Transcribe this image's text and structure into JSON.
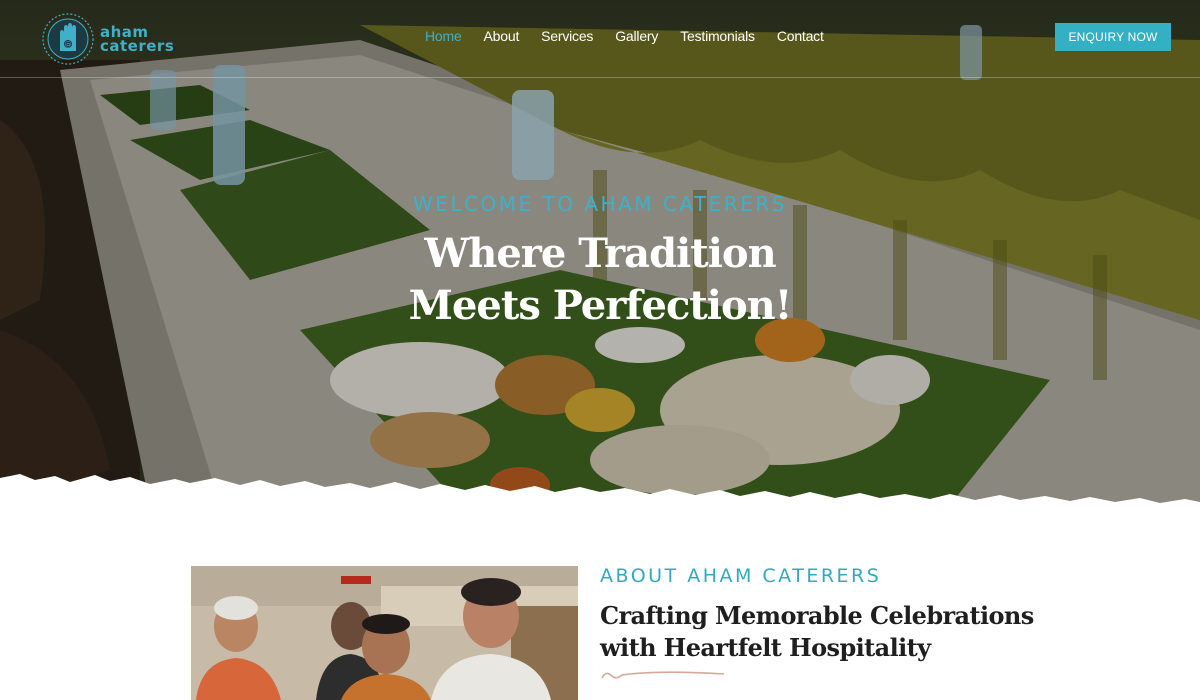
{
  "brand": {
    "name_line1": "aham",
    "name_line2": "caterers",
    "accent_color": "#33b0c4",
    "logo_icon": "hand-logo-icon"
  },
  "nav": {
    "items": [
      {
        "label": "Home",
        "active": true
      },
      {
        "label": "About",
        "active": false
      },
      {
        "label": "Services",
        "active": false
      },
      {
        "label": "Gallery",
        "active": false
      },
      {
        "label": "Testimonials",
        "active": false
      },
      {
        "label": "Contact",
        "active": false
      }
    ],
    "cta_label": "ENQUIRY NOW"
  },
  "hero": {
    "kicker": "WELCOME TO AHAM CATERERS",
    "title_line1": "Where Tradition",
    "title_line2": "Meets Perfection!"
  },
  "about": {
    "kicker": "ABOUT AHAM CATERERS",
    "title_line1": "Crafting Memorable Celebrations",
    "title_line2": "with Heartfelt Hospitality"
  }
}
